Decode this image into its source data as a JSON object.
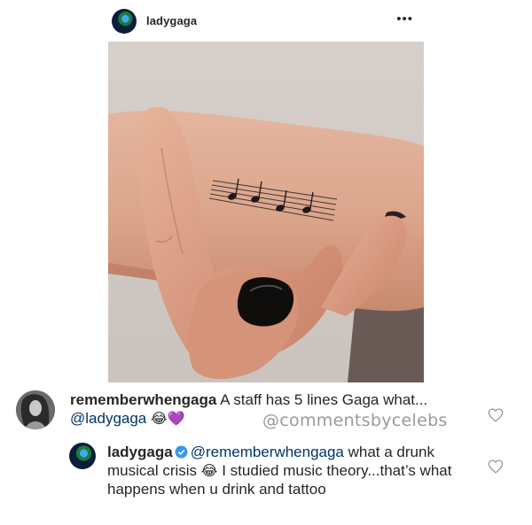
{
  "post": {
    "username": "ladygaga",
    "more_icon": "more-options-icon"
  },
  "comments": [
    {
      "username": "rememberwhengaga",
      "text": "A staff has 5 lines Gaga what...",
      "mention": "@ladygaga",
      "emojis": "😂💜",
      "watermark": "@commentsbycelebs",
      "like_icon": "heart-icon"
    },
    {
      "username": "ladygaga",
      "verified": true,
      "mention": "@rememberwhengaga",
      "text_before_emoji": "what a drunk musical crisis",
      "emoji": "😂",
      "text_after_emoji": "I studied music theory...that’s what happens when u drink and tattoo",
      "like_icon": "heart-icon"
    }
  ],
  "colors": {
    "text": "#262626",
    "mention": "#003569",
    "verified": "#3897f0",
    "watermark": "#9a9a9a"
  }
}
